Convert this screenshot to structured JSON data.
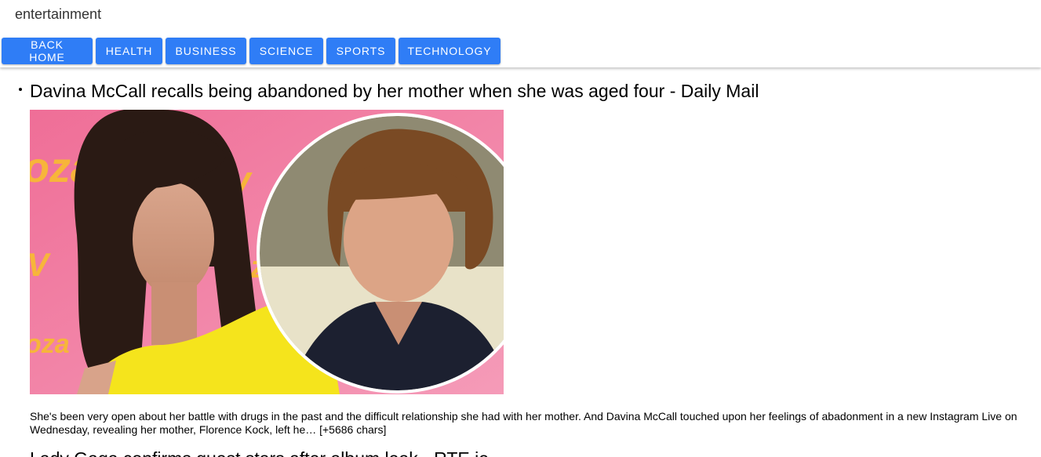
{
  "page": {
    "section_title": "entertainment"
  },
  "nav": {
    "buttons": [
      "BACK HOME",
      "HEALTH",
      "BUSINESS",
      "SCIENCE",
      "SPORTS",
      "TECHNOLOGY"
    ]
  },
  "articles": [
    {
      "headline": "Davina McCall recalls being abandoned by her mother when she was aged four - Daily Mail",
      "description": "She's been very open about her battle with drugs in the past and the difficult relationship she had with her mother.  And Davina McCall touched upon her feelings of abadonment in a new Instagram Live on Wednesday, revealing her mother, Florence Kock, left he… [+5686 chars]",
      "image_logo_text": "oza!",
      "image_logo_text_2": "oza",
      "image_logo_text_3": "oza"
    },
    {
      "headline": "Lady Gaga confirms guest stars after album leak - RTE.ie"
    }
  ],
  "colors": {
    "accent": "#2f7df6",
    "image_bg": "#f27fa4",
    "dress": "#f5e41c"
  }
}
